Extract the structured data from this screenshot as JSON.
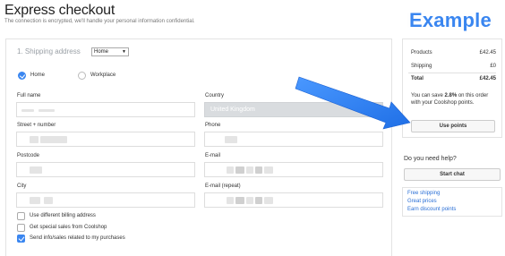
{
  "header": {
    "title": "Express checkout",
    "subtitle": "The connection is encrypted, we'll handle your personal information confidential.",
    "example_banner": "Example"
  },
  "shipping": {
    "section_title": "1. Shipping address",
    "address_select": "Home",
    "radios": [
      {
        "label": "Home",
        "checked": true
      },
      {
        "label": "Workplace",
        "checked": false
      }
    ]
  },
  "fields": {
    "full_name": {
      "label": "Full name",
      "value": ""
    },
    "country": {
      "label": "Country",
      "value": "United Kingdom"
    },
    "street": {
      "label": "Street + number",
      "value": ""
    },
    "phone": {
      "label": "Phone",
      "value": ""
    },
    "postcode": {
      "label": "Postcode",
      "value": ""
    },
    "email": {
      "label": "E-mail",
      "value": ""
    },
    "city": {
      "label": "City",
      "value": ""
    },
    "email_repeat": {
      "label": "E-mail (repeat)",
      "value": ""
    }
  },
  "options": [
    {
      "label": "Use different billing address",
      "checked": false
    },
    {
      "label": "Get special sales from Coolshop",
      "checked": false
    },
    {
      "label": "Send info/sales related to my purchases",
      "checked": true
    }
  ],
  "summary": {
    "products_label": "Products",
    "products_value": "£42.45",
    "shipping_label": "Shipping",
    "shipping_value": "£0",
    "total_label": "Total",
    "total_value": "£42.45",
    "save_prefix": "You can save ",
    "save_percent": "2.8%",
    "save_suffix": " on this order with your Coolshop points.",
    "use_points_button": "Use points"
  },
  "help": {
    "title": "Do you need help?",
    "start_chat_button": "Start chat",
    "links": [
      "Free shipping",
      "Great prices",
      "Earn discount points"
    ]
  },
  "colors": {
    "accent": "#3a86f0",
    "link": "#2a6fd6",
    "disabled_field": "#d9dcdf"
  }
}
